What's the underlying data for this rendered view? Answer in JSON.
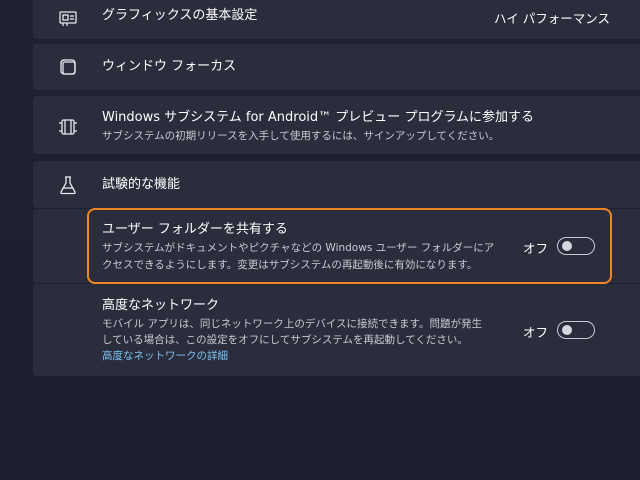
{
  "graphics": {
    "title": "グラフィックスの基本設定",
    "value": "ハイ パフォーマンス",
    "icon": "graphics-card-icon"
  },
  "window_focus": {
    "title": "ウィンドウ フォーカス",
    "icon": "window-icon"
  },
  "preview_program": {
    "title": "Windows サブシステム for Android™ プレビュー プログラムに参加する",
    "description": "サブシステムの初期リリースを入手して使用するには、サインアップしてください。",
    "icon": "film-icon"
  },
  "experimental": {
    "header": "試験的な機能",
    "icon": "flask-icon",
    "share_folders": {
      "title": "ユーザー フォルダーを共有する",
      "description_line1": "サブシステムがドキュメントやピクチャなどの Windows ユーザー フォルダーにア",
      "description_line2": "クセスできるようにします。変更はサブシステムの再起動後に有効になります。",
      "toggle_label": "オフ",
      "toggle_on": false
    },
    "advanced_network": {
      "title": "高度なネットワーク",
      "description_line1": "モバイル アプリは、同じネットワーク上のデバイスに接続できます。問題が発生",
      "description_line2": "している場合は、この設定をオフにしてサブシステムを再起動してください。",
      "link": "高度なネットワークの詳細",
      "toggle_label": "オフ",
      "toggle_on": false
    }
  },
  "colors": {
    "background": "#1f2030",
    "card": "#2b2d3c",
    "focus_ring": "#f08524",
    "link": "#7cc3f5"
  }
}
